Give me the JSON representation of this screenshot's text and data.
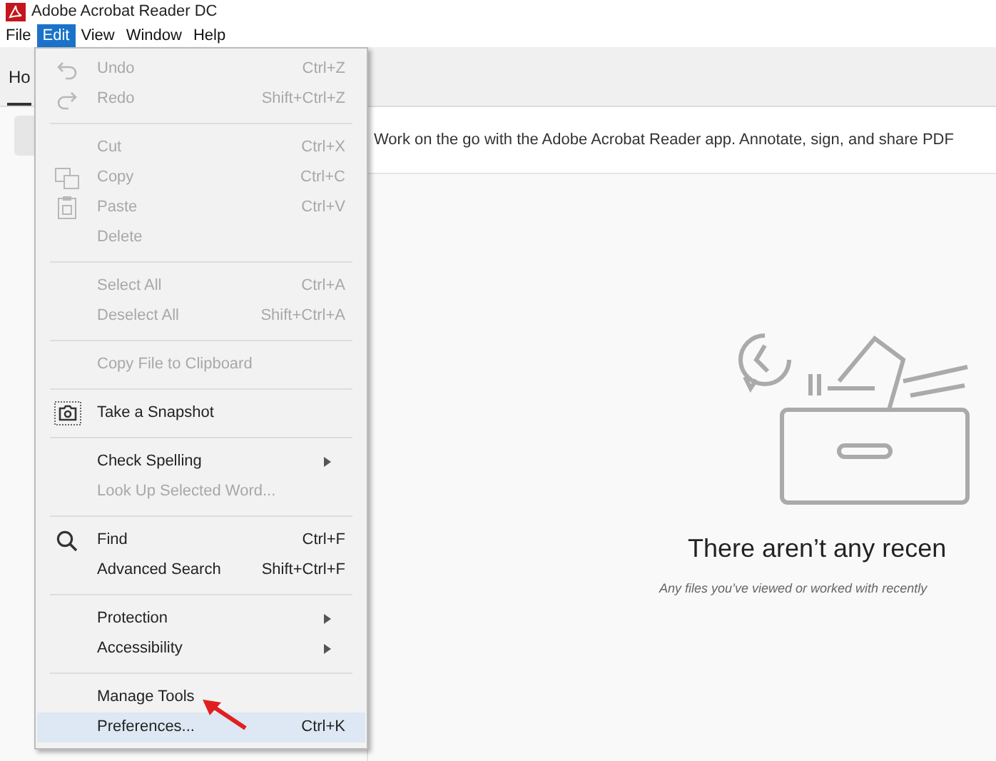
{
  "window": {
    "title": "Adobe Acrobat Reader DC"
  },
  "menubar": [
    {
      "label": "File",
      "selected": false
    },
    {
      "label": "Edit",
      "selected": true
    },
    {
      "label": "View",
      "selected": false
    },
    {
      "label": "Window",
      "selected": false
    },
    {
      "label": "Help",
      "selected": false
    }
  ],
  "tabs": [
    {
      "label": "Ho",
      "selected": true
    }
  ],
  "banner": {
    "text": "Work on the go with the Adobe Acrobat Reader app. Annotate, sign, and share PDF"
  },
  "empty_state": {
    "title": "There aren’t any recen",
    "subtitle": "Any files you’ve viewed or worked with recently"
  },
  "edit_menu": [
    {
      "kind": "item",
      "label": "Undo",
      "shortcut": "Ctrl+Z",
      "disabled": true,
      "selected": false
    },
    {
      "kind": "item",
      "label": "Redo",
      "shortcut": "Shift+Ctrl+Z",
      "disabled": true,
      "selected": false
    },
    {
      "kind": "separator"
    },
    {
      "kind": "item",
      "label": "Cut",
      "shortcut": "Ctrl+X",
      "disabled": true,
      "selected": false
    },
    {
      "kind": "item",
      "label": "Copy",
      "shortcut": "Ctrl+C",
      "disabled": true,
      "selected": false
    },
    {
      "kind": "item",
      "label": "Paste",
      "shortcut": "Ctrl+V",
      "disabled": true,
      "selected": false
    },
    {
      "kind": "item",
      "label": "Delete",
      "disabled": true,
      "selected": false
    },
    {
      "kind": "separator"
    },
    {
      "kind": "item",
      "label": "Select All",
      "shortcut": "Ctrl+A",
      "disabled": true,
      "selected": false
    },
    {
      "kind": "item",
      "label": "Deselect All",
      "shortcut": "Shift+Ctrl+A",
      "disabled": true,
      "selected": false
    },
    {
      "kind": "separator"
    },
    {
      "kind": "item",
      "label": "Copy File to Clipboard",
      "disabled": true,
      "selected": false
    },
    {
      "kind": "separator"
    },
    {
      "kind": "item",
      "label": "Take a Snapshot",
      "disabled": false,
      "selected": false
    },
    {
      "kind": "separator"
    },
    {
      "kind": "submenu",
      "label": "Check Spelling",
      "disabled": false,
      "selected": false
    },
    {
      "kind": "item",
      "label": "Look Up Selected Word...",
      "disabled": true,
      "selected": false
    },
    {
      "kind": "separator"
    },
    {
      "kind": "item",
      "label": "Find",
      "shortcut": "Ctrl+F",
      "disabled": false,
      "selected": false
    },
    {
      "kind": "item",
      "label": "Advanced Search",
      "shortcut": "Shift+Ctrl+F",
      "disabled": false,
      "selected": false
    },
    {
      "kind": "separator"
    },
    {
      "kind": "submenu",
      "label": "Protection",
      "disabled": false,
      "selected": false
    },
    {
      "kind": "submenu",
      "label": "Accessibility",
      "disabled": false,
      "selected": false
    },
    {
      "kind": "separator"
    },
    {
      "kind": "item",
      "label": "Manage Tools",
      "disabled": false,
      "selected": false
    },
    {
      "kind": "item",
      "label": "Preferences...",
      "shortcut": "Ctrl+K",
      "disabled": false,
      "selected": true
    }
  ]
}
